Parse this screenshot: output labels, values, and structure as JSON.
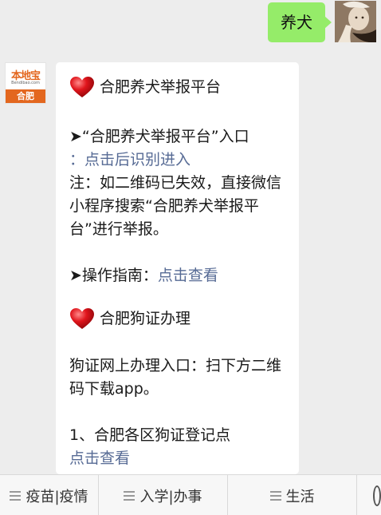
{
  "outgoing_message": {
    "text": "养犬"
  },
  "bot": {
    "logo_name": "本地宝",
    "logo_url": "Bendibao.com",
    "logo_city": "合肥"
  },
  "card": {
    "section1_title": "合肥养犬举报平台",
    "entry_prefix": "➤“合肥养犬举报平台”入口",
    "entry_link": "：点击后识别进入",
    "note": "注：如二维码已失效，直接微信小程序搜索“合肥养犬举报平台”进行举报。",
    "guide_prefix": "➤操作指南：",
    "guide_link": "点击查看",
    "section2_title": "合肥狗证办理",
    "online_text": "狗证网上办理入口：扫下方二维码下载app。",
    "item1": "1、合肥各区狗证登记点",
    "item1_link": "点击查看"
  },
  "menu": {
    "items": [
      "疫苗|疫情",
      "入学|办事",
      "生活"
    ]
  },
  "icons": {
    "heart": "heart-icon",
    "menu": "menu-lines-icon",
    "keyboard": "keyboard-icon"
  },
  "colors": {
    "outgoing_bubble": "#95ec69",
    "link": "#576b95",
    "brand": "#e3671f",
    "heart": "#d9141a"
  }
}
